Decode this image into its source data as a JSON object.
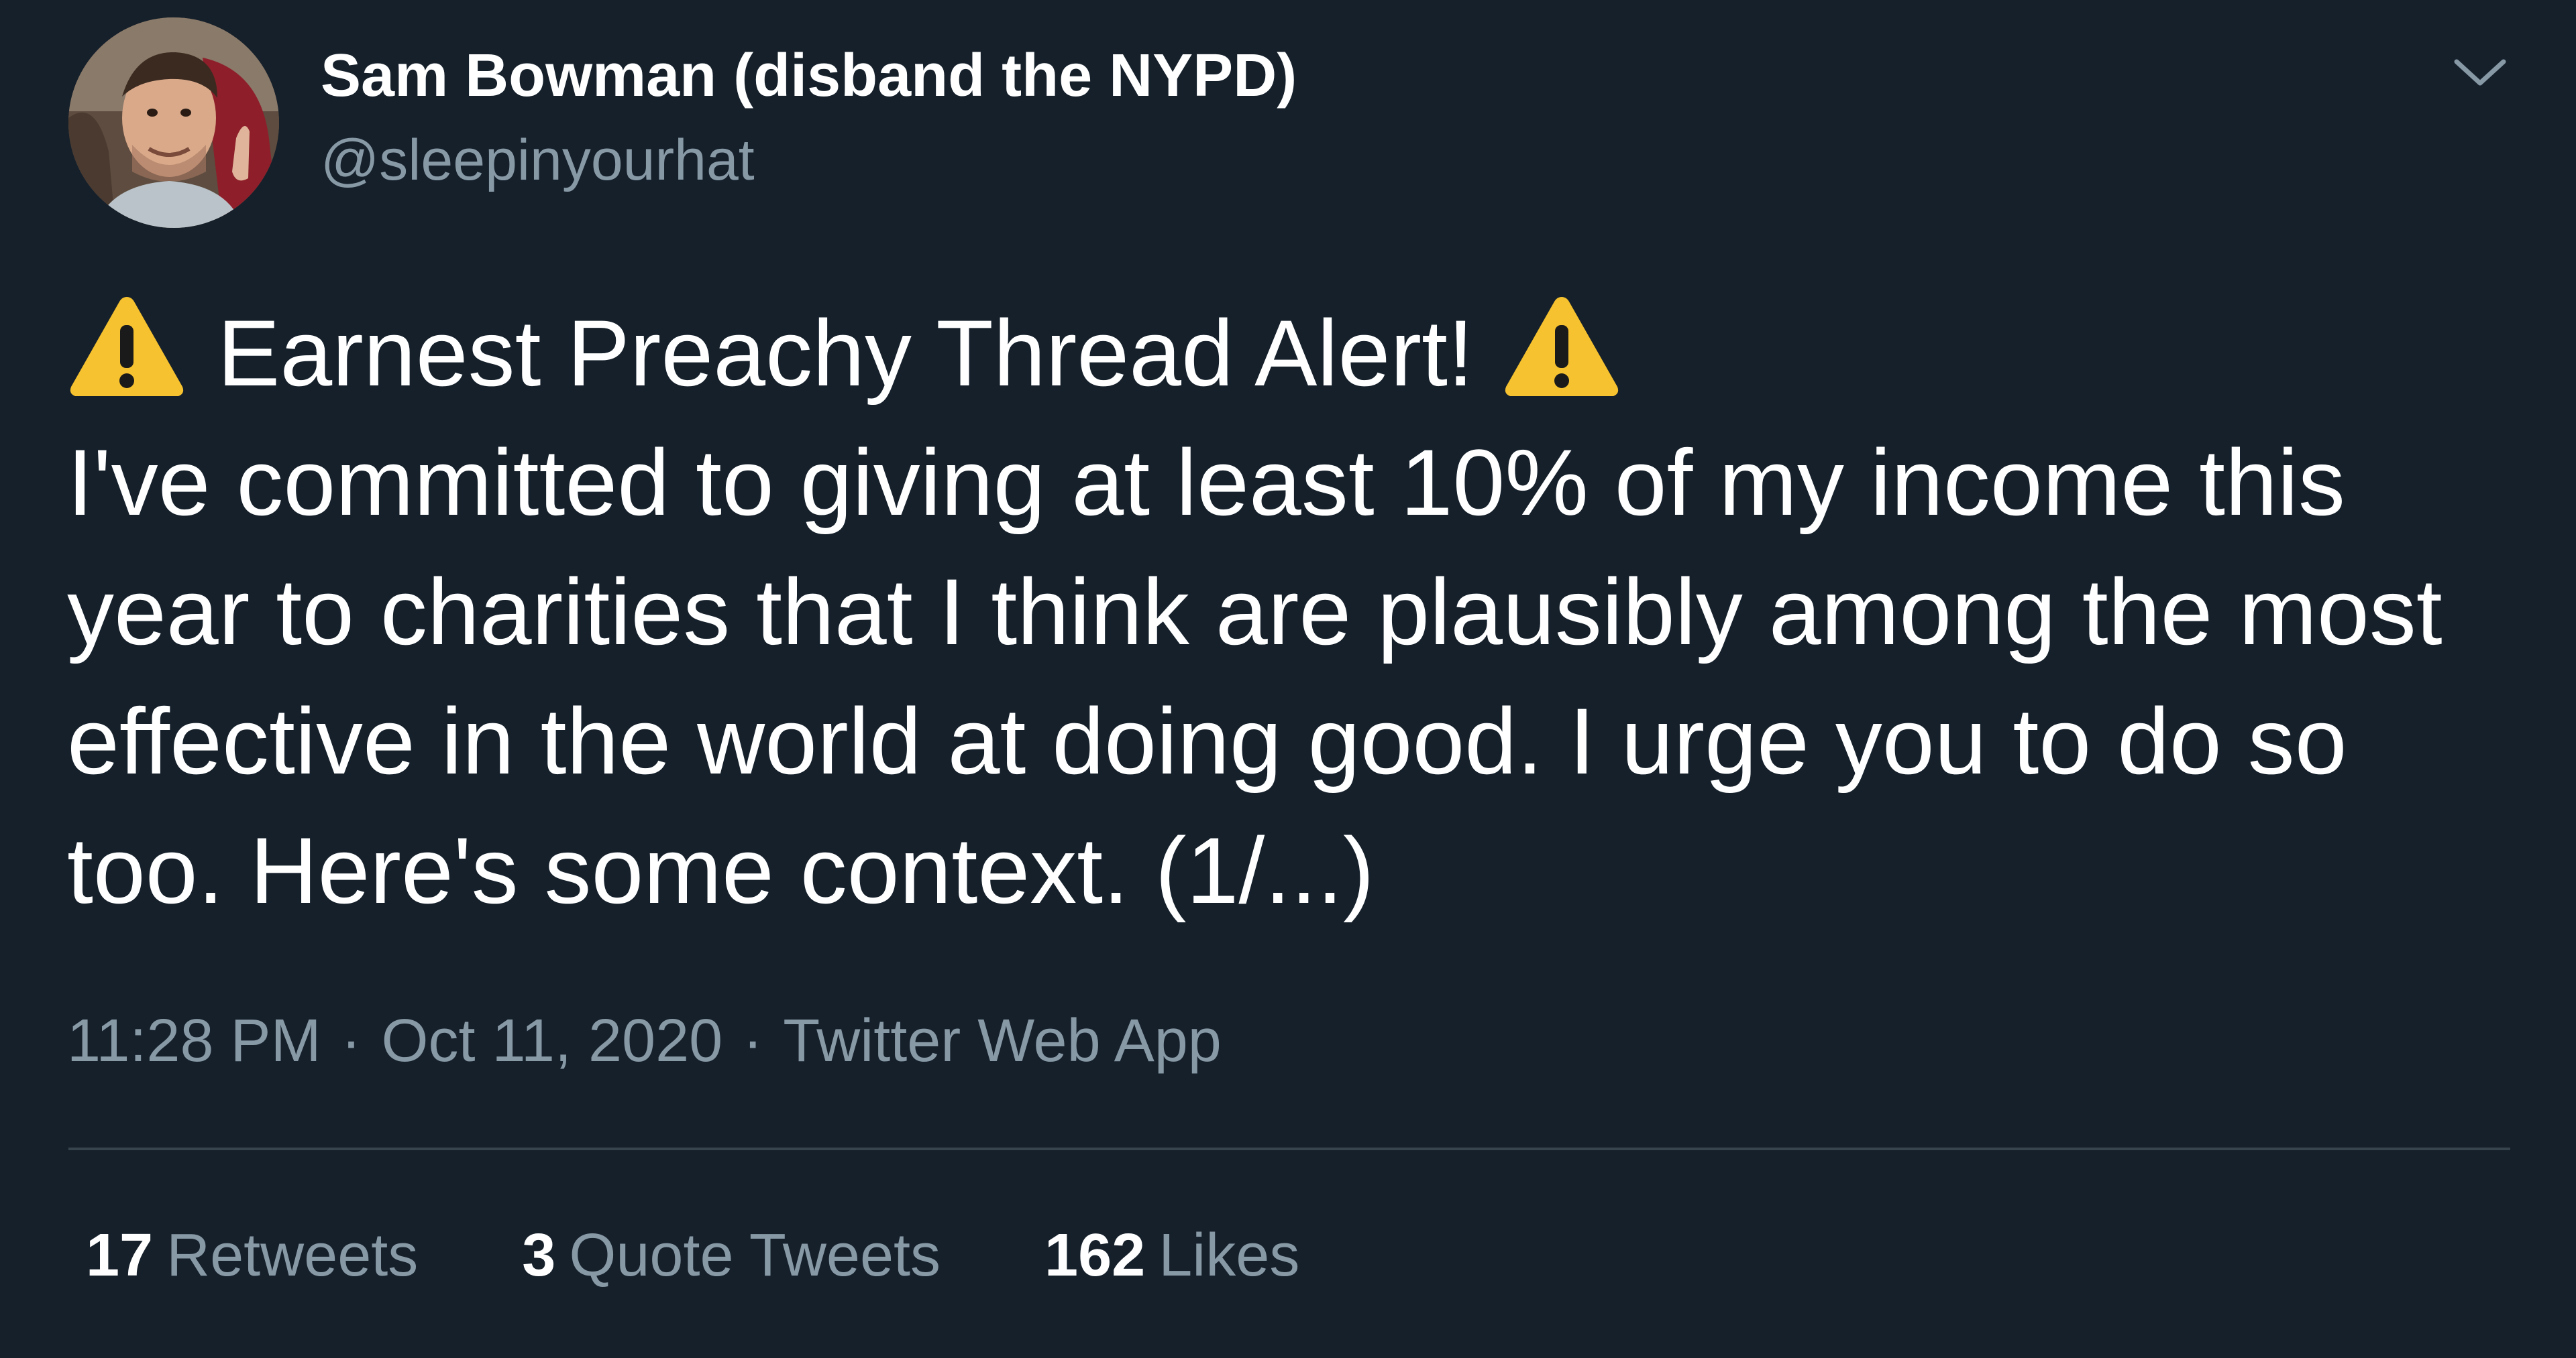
{
  "author": {
    "name": "Sam Bowman (disband the NYPD)",
    "handle": "@sleepinyourhat"
  },
  "tweet": {
    "headline_icon": "warning-sign-emoji",
    "headline": "Earnest Preachy Thread Alert!",
    "lines": [
      "I've committed to giving at least 10% of my income this",
      "year to charities that I think are plausibly among the most",
      "effective in the world at doing good. I urge you to do so",
      "too. Here's some context. (1/...)"
    ]
  },
  "meta": {
    "time": "11:28 PM",
    "separator": "·",
    "date": "Oct 11, 2020",
    "source": "Twitter Web App"
  },
  "stats": {
    "retweets": {
      "count": "17",
      "label": "Retweets"
    },
    "quote_tweets": {
      "count": "3",
      "label": "Quote Tweets"
    },
    "likes": {
      "count": "162",
      "label": "Likes"
    }
  },
  "colors": {
    "background": "#15202b",
    "primary_text": "#ffffff",
    "secondary_text": "#8899a6",
    "divider": "#38444d",
    "warning_yellow": "#f7c22f"
  }
}
